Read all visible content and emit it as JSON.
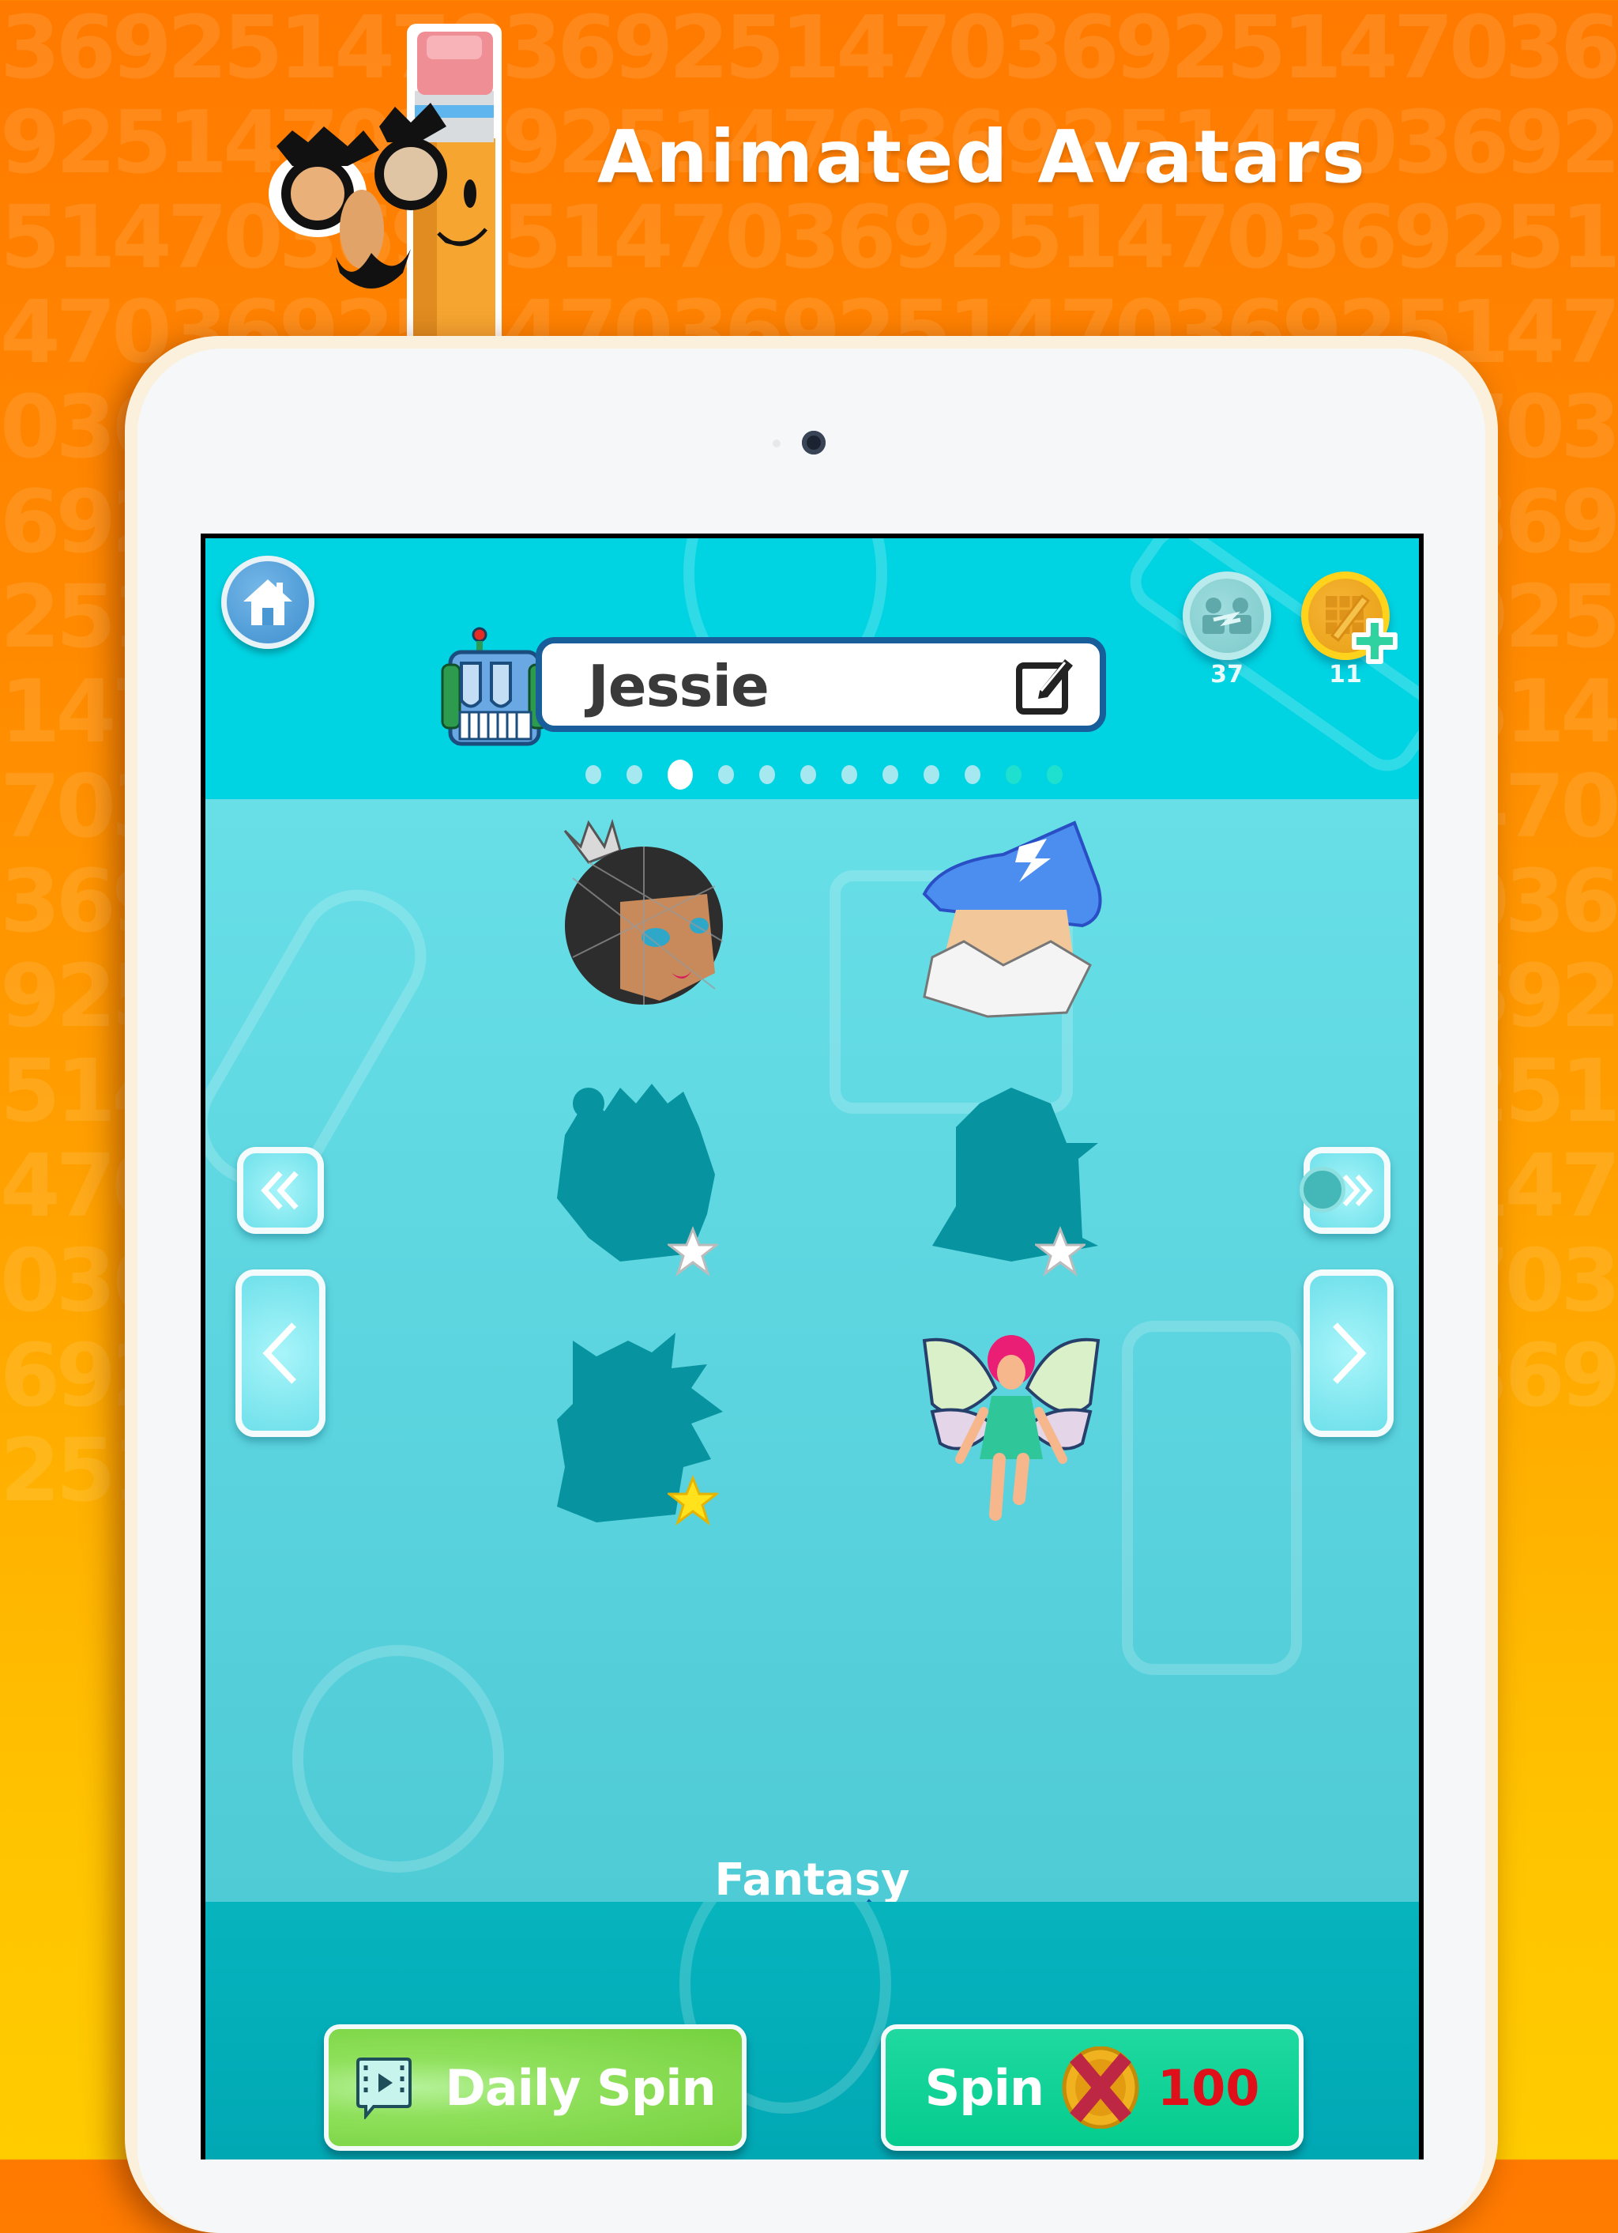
{
  "headline": "Animated Avatars",
  "background_pattern": "36925147036925147036925147036925147036925147036925147036925147036925147036925147036925147036925147036925147036925147036925147036925147036925147036925147036925147036925147036925147036925147036925147036925147036925147036925147036925147036925147036925147036925147036925147036925147036925147036925147036925147036925147036925147036925147036925147036925147036925147036925147036925147036925147036925147036925147036925147036925147036925147036925147",
  "colors": {
    "background_top": "#ff7a00",
    "background_bottom": "#ffcc00",
    "header_bar": "#00d3e2",
    "content_area": "#5ad3dd",
    "footer_bar": "#00a8b4",
    "name_box_border": "#175e9a",
    "daily_spin_button": "#8fe05b",
    "spin_button": "#05cc8e",
    "price_text": "#e0101b"
  },
  "header": {
    "home_icon": "home-icon",
    "player_name": "Jessie",
    "edit_icon": "edit-icon",
    "player_avatar_icon": "robot-avatar-icon",
    "currencies": [
      {
        "name": "multiplayer-tokens",
        "icon": "versus-coin-icon",
        "count": "37"
      },
      {
        "name": "puzzle-coins",
        "icon": "pencil-coin-icon",
        "count": "11",
        "add_icon": "plus-icon"
      }
    ],
    "pager": {
      "total_pages": 12,
      "active_index": 2,
      "locked_from_index": 10
    }
  },
  "avatars": [
    {
      "name": "spider-queen",
      "state": "unlocked",
      "star": null
    },
    {
      "name": "wizard",
      "state": "unlocked",
      "star": null
    },
    {
      "name": "forest-hair",
      "state": "locked",
      "star": "white"
    },
    {
      "name": "helmet",
      "state": "locked",
      "star": "white"
    },
    {
      "name": "spiky-hair",
      "state": "locked",
      "star": "gold"
    },
    {
      "name": "fairy",
      "state": "unlocked",
      "star": null
    }
  ],
  "navigation": {
    "first_page_icon": "double-chevron-left-icon",
    "prev_page_icon": "chevron-left-icon",
    "last_page_icon": "double-chevron-right-icon",
    "next_page_icon": "chevron-right-icon"
  },
  "category": {
    "label": "Fantasy",
    "icon": "mystery-gift-icon"
  },
  "footer": {
    "daily_spin": {
      "label": "Daily Spin",
      "icon": "video-icon"
    },
    "spin": {
      "label": "Spin",
      "icon": "coin-crossed-icon",
      "price": "100"
    }
  }
}
